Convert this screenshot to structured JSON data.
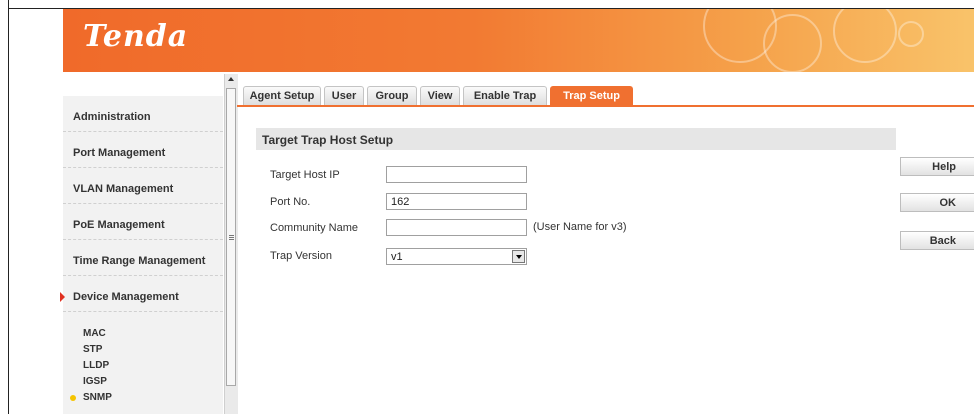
{
  "brand": {
    "logo_text": "Tenda",
    "header_color": "#f06a2a",
    "accent_color": "#f07030"
  },
  "sidebar": {
    "items": [
      {
        "label": "Administration"
      },
      {
        "label": "Port Management"
      },
      {
        "label": "VLAN Management"
      },
      {
        "label": "PoE Management"
      },
      {
        "label": "Time Range Management"
      },
      {
        "label": "Device Management",
        "active": true
      }
    ],
    "subitems": [
      {
        "label": "MAC"
      },
      {
        "label": "STP"
      },
      {
        "label": "LLDP"
      },
      {
        "label": "IGSP"
      },
      {
        "label": "SNMP",
        "active": true
      }
    ]
  },
  "tabs": [
    {
      "label": "Agent Setup"
    },
    {
      "label": "User"
    },
    {
      "label": "Group"
    },
    {
      "label": "View"
    },
    {
      "label": "Enable Trap"
    },
    {
      "label": "Trap Setup",
      "active": true
    }
  ],
  "form": {
    "section_title": "Target Trap Host Setup",
    "target_ip": {
      "label": "Target Host IP",
      "value": ""
    },
    "port": {
      "label": "Port No.",
      "value": "162"
    },
    "community": {
      "label": "Community Name",
      "value": "",
      "hint": "(User Name for v3)"
    },
    "trap_version": {
      "label": "Trap Version",
      "value": "v1"
    }
  },
  "actions": {
    "help": "Help",
    "ok": "OK",
    "back": "Back"
  }
}
